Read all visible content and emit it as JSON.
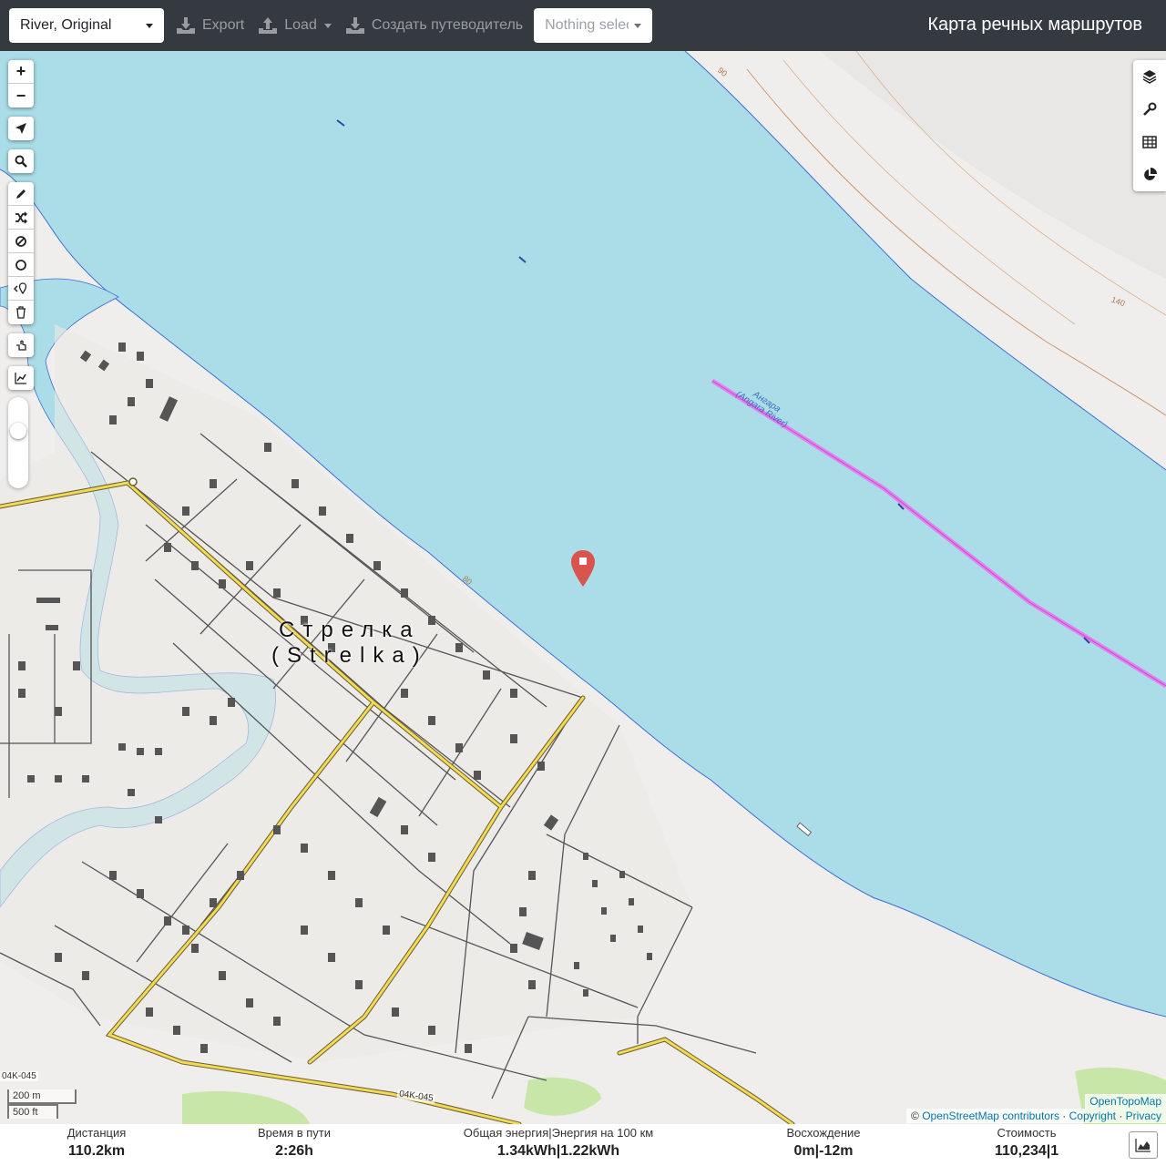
{
  "navbar": {
    "profile": "River, Original",
    "export_label": "Export",
    "load_label": "Load",
    "guide_label": "Создать путеводитель",
    "selection_placeholder": "Nothing selected",
    "brand": "Карта речных маршрутов"
  },
  "map": {
    "town_name": "Стрелка",
    "town_name_latin": "(Strelka)",
    "river_name": "Ангара",
    "river_name_latin": "(Angara River)",
    "road_label": "04K-045",
    "contour_labels": [
      "90",
      "140",
      "80"
    ],
    "scale_metric": "200 m",
    "scale_imperial": "500 ft",
    "attribution_top": "OpenTopoMap",
    "attribution": {
      "prefix": "©",
      "osm": "OpenStreetMap contributors",
      "copyright": "Copyright",
      "privacy": "Privacy"
    },
    "left_tools": {
      "zoom_in": "+",
      "zoom_out": "−"
    }
  },
  "stats": {
    "distance_label": "Дистанция",
    "distance_value": "110.2km",
    "time_label": "Время в пути",
    "time_value": "2:26h",
    "energy_label": "Общая энергия|Энергия на 100 км",
    "energy_value": "1.34kWh|1.22kWh",
    "ascent_label": "Восхождение",
    "ascent_value": "0m|-12m",
    "cost_label": "Стоимость",
    "cost_value": "110,234|1"
  },
  "colors": {
    "water": "#aadde7",
    "route": "#e680f0",
    "navbar": "#343a40",
    "road": "#f1d95a",
    "building": "#555555",
    "marker": "#d9534f"
  }
}
